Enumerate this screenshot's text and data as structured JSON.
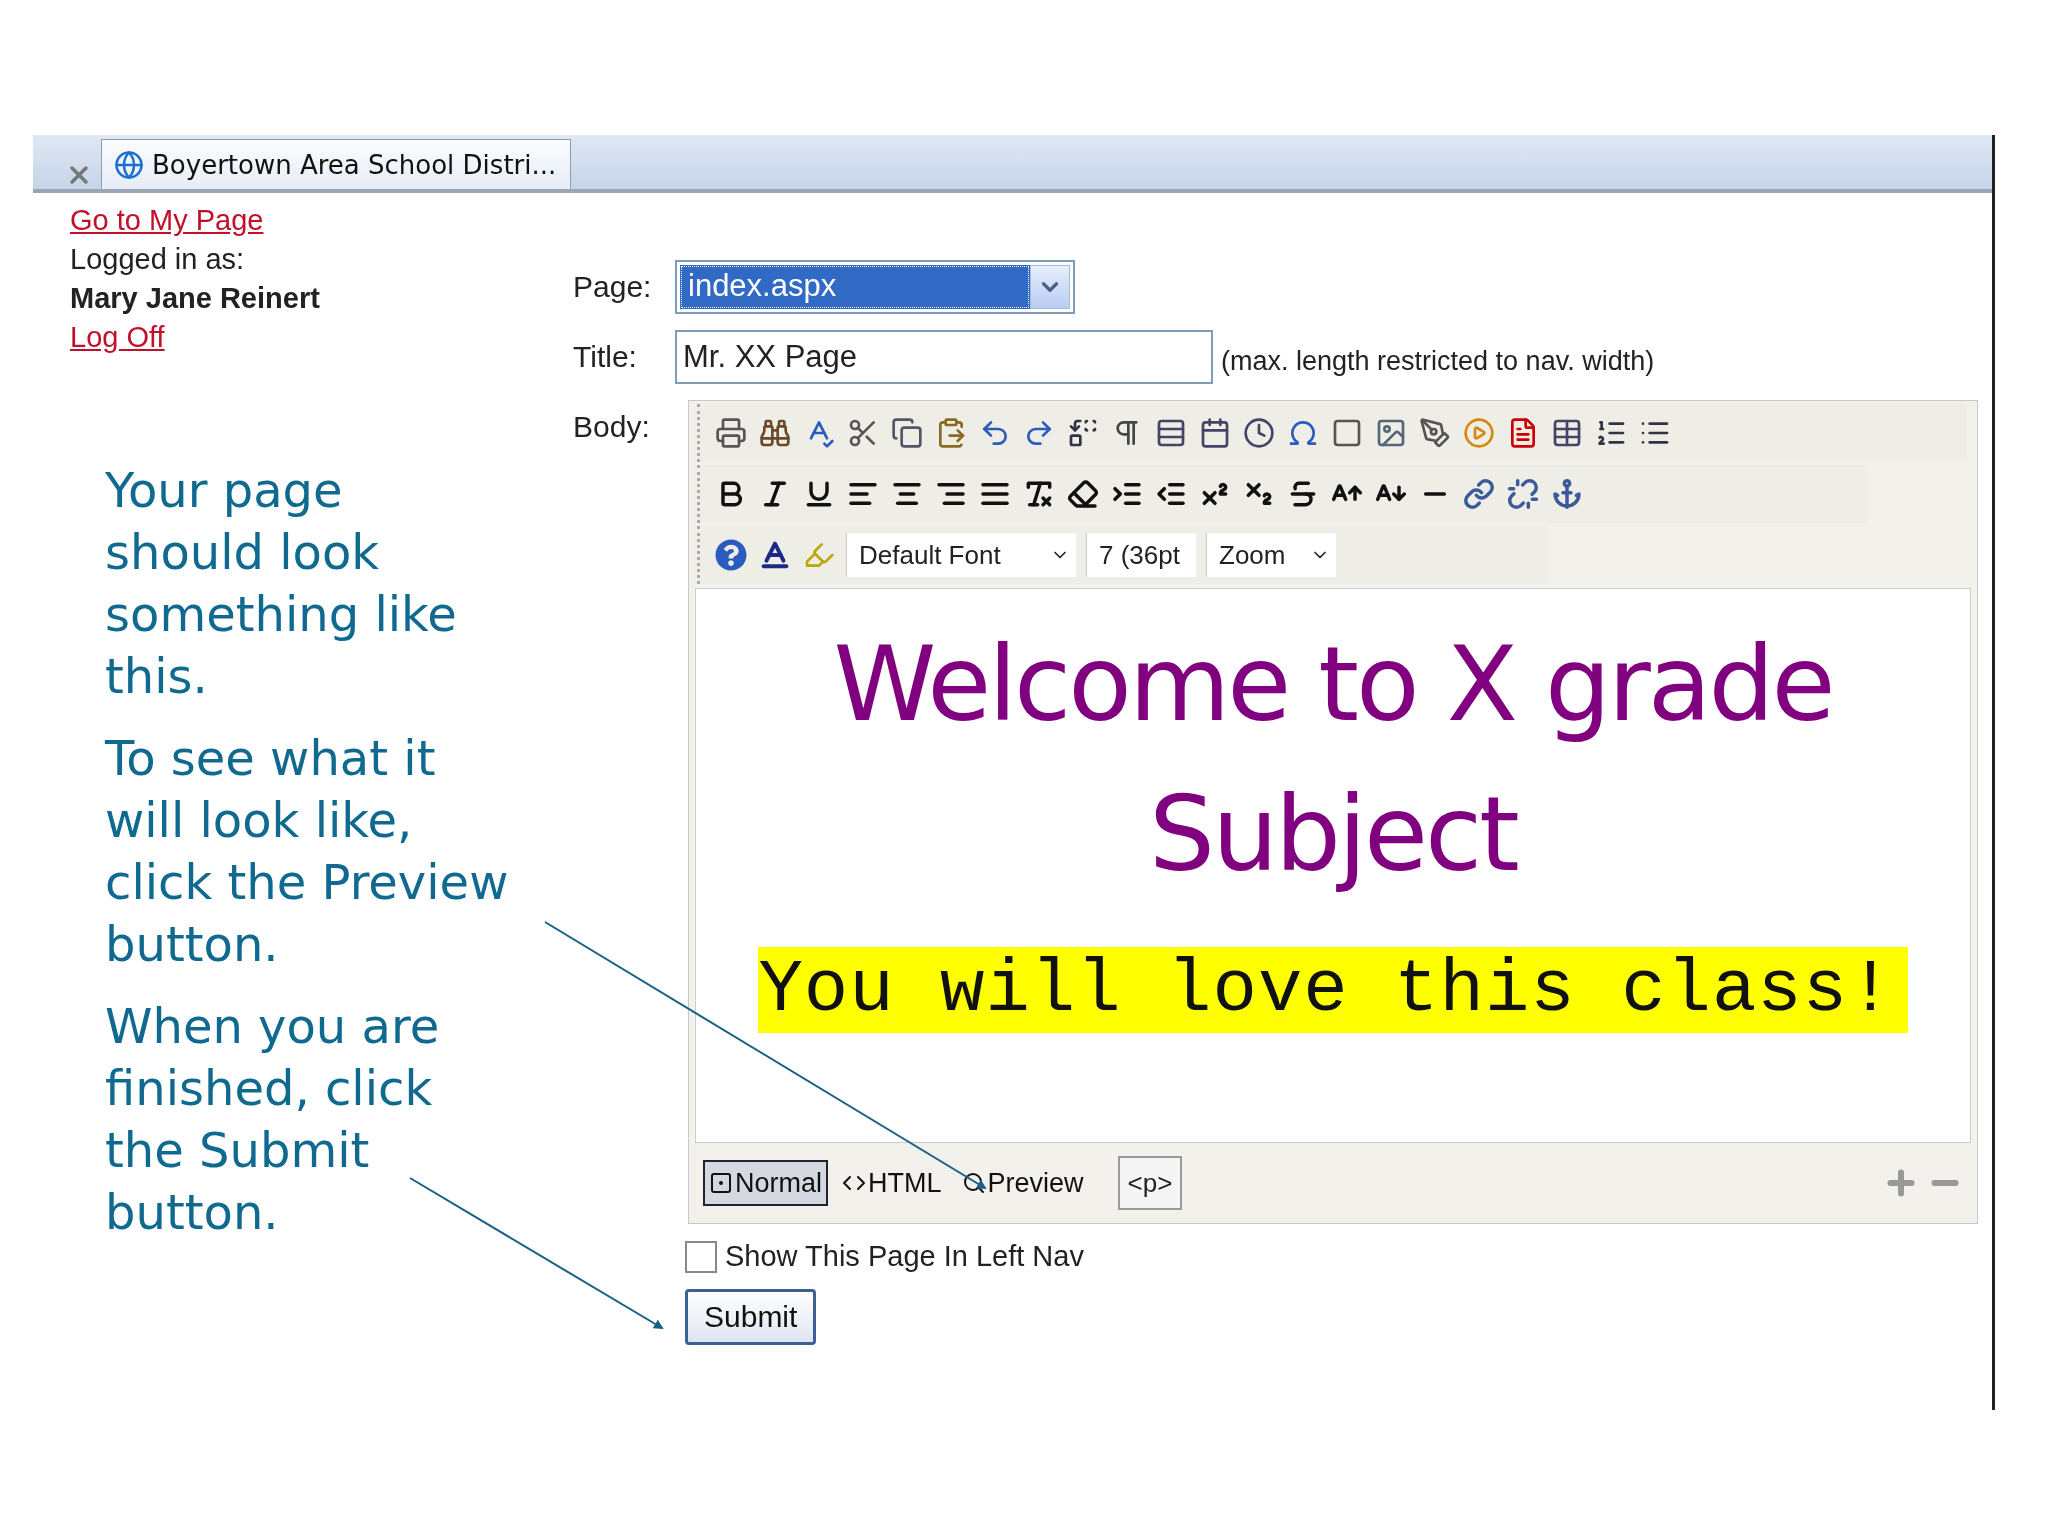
{
  "browser_tab": {
    "title": "Boyertown Area School Distri..."
  },
  "user_panel": {
    "my_page_link": "Go to My Page",
    "logged_in_label": "Logged in as:",
    "user_name": "Mary Jane Reinert",
    "log_off_link": "Log Off"
  },
  "instructions": [
    "Your page\nshould look\nsomething like\nthis.",
    "To see what it\nwill look like,\nclick the Preview\nbutton.",
    "When you are\nfinished, click\nthe Submit\nbutton."
  ],
  "form": {
    "page_label": "Page:",
    "page_value": "index.aspx",
    "title_label": "Title:",
    "title_value": "Mr. XX Page",
    "title_hint": "(max. length restricted to nav. width)",
    "body_label": "Body:"
  },
  "editor": {
    "font_select": "Default Font",
    "size_select": "7 (36pt",
    "zoom_select": "Zoom",
    "heading": "Welcome to X grade Subject",
    "highlight": "You will love this class!",
    "modes": [
      {
        "label": "Normal",
        "selected": true
      },
      {
        "label": "HTML",
        "selected": false
      },
      {
        "label": "Preview",
        "selected": false
      }
    ],
    "tag_path": "<p>"
  },
  "show_in_nav": {
    "label": "Show This Page In Left Nav",
    "checked": false
  },
  "submit": "Submit"
}
